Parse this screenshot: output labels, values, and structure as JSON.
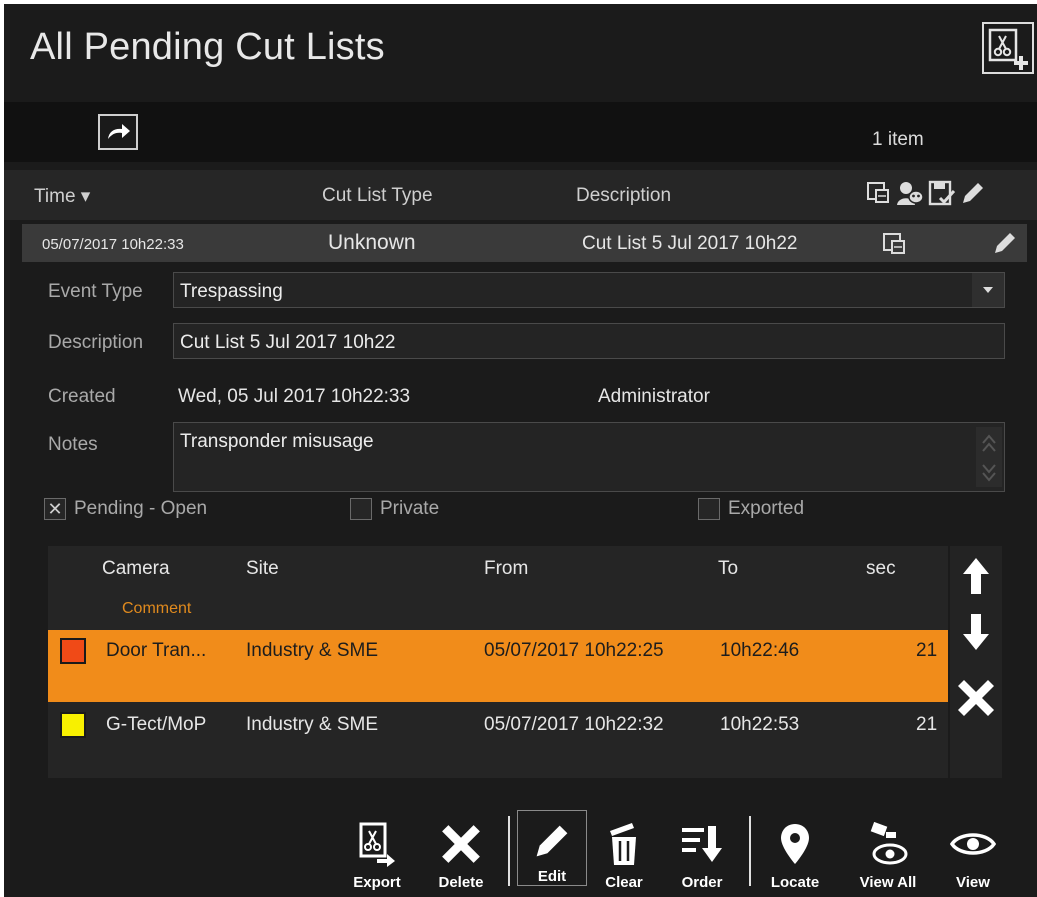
{
  "header": {
    "title": "All Pending Cut Lists",
    "new_icon": "new-cutlist-icon"
  },
  "toolbar": {
    "count": "1 item",
    "refresh_icon": "redo-icon"
  },
  "list": {
    "columns": {
      "time": "Time ▾",
      "type": "Cut List Type",
      "description": "Description"
    },
    "row": {
      "time": "05/07/2017 10h22:33",
      "type": "Unknown",
      "description": "Cut List 5 Jul 2017 10h22"
    }
  },
  "detail": {
    "event_type_label": "Event Type",
    "event_type_value": "Trespassing",
    "description_label": "Description",
    "description_value": "Cut List 5 Jul 2017 10h22",
    "created_label": "Created",
    "created_value": "Wed, 05 Jul 2017  10h22:33",
    "created_by": "Administrator",
    "notes_label": "Notes",
    "notes_value": "Transponder misusage",
    "pending_label": "Pending - Open",
    "pending_checked": "✕",
    "private_label": "Private",
    "exported_label": "Exported"
  },
  "cameras": {
    "columns": {
      "camera": "Camera",
      "site": "Site",
      "from": "From",
      "to": "To",
      "sec": "sec",
      "comment": "Comment"
    },
    "rows": [
      {
        "camera": "Door Tran...",
        "site": "Industry & SME",
        "from": "05/07/2017 10h22:25",
        "to": "10h22:46",
        "sec": "21",
        "color": "#f04a17"
      },
      {
        "camera": "G-Tect/MoP",
        "site": "Industry & SME",
        "from": "05/07/2017 10h22:32",
        "to": "10h22:53",
        "sec": "21",
        "color": "#f8f000"
      }
    ]
  },
  "actions": {
    "export": "Export",
    "delete": "Delete",
    "edit": "Edit",
    "clear": "Clear",
    "order": "Order",
    "locate": "Locate",
    "view_all": "View All",
    "view": "View"
  },
  "colors": {
    "accent": "#f18c1a",
    "background": "#1b1b1b"
  }
}
